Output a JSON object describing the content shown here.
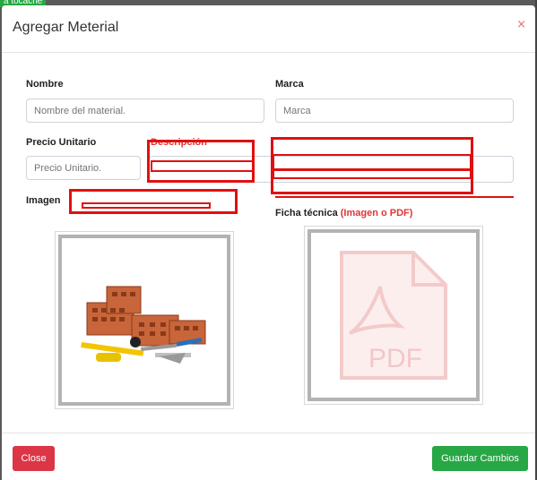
{
  "backdrop": {
    "tag_text": "a tocache"
  },
  "modal": {
    "title": "Agregar Meterial",
    "close_x": "×"
  },
  "form": {
    "nombre": {
      "label": "Nombre",
      "placeholder": "Nombre del material."
    },
    "marca": {
      "label": "Marca",
      "placeholder": "Marca"
    },
    "precio": {
      "label": "Precio Unitario",
      "placeholder": "Precio Unitario."
    },
    "descripcion": {
      "label": "Descripción"
    },
    "imagen": {
      "label": "Imagen"
    },
    "ficha": {
      "label": "Ficha técnica",
      "label_suffix": "(Imagen o PDF)"
    }
  },
  "thumbnails": {
    "imagen_icon": "bricks-and-tools-image",
    "ficha_icon": "pdf-file-icon",
    "pdf_text": "PDF"
  },
  "footer": {
    "close_label": "Close",
    "save_label": "Guardar Cambios"
  },
  "colors": {
    "danger": "#dc3545",
    "success": "#28a745",
    "accent_red": "#e03535",
    "redaction": "#e01010"
  }
}
